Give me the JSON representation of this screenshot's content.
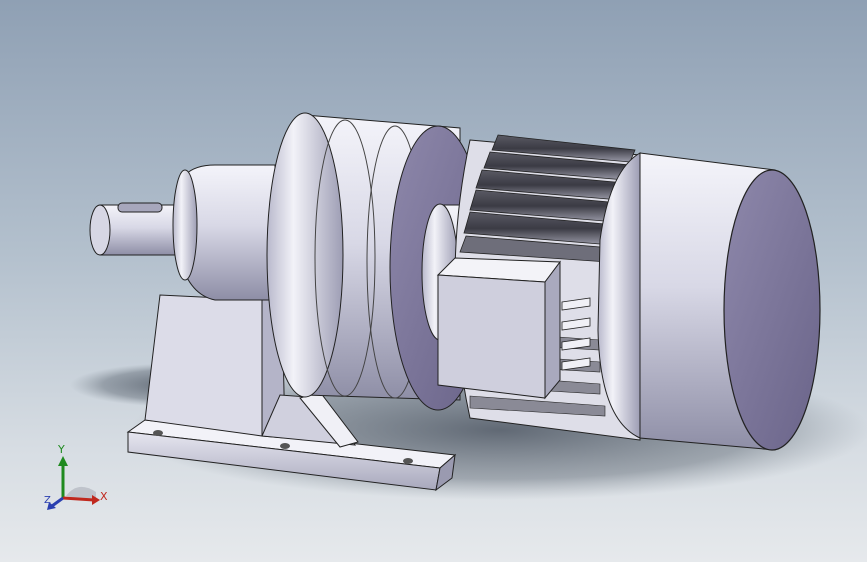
{
  "triad": {
    "x_label": "X",
    "y_label": "Y",
    "z_label": "Z"
  },
  "colors": {
    "x_axis": "#c0281e",
    "y_axis": "#1f8a1f",
    "z_axis": "#2a3fb0"
  },
  "icons": [
    "reference-triad-icon"
  ]
}
